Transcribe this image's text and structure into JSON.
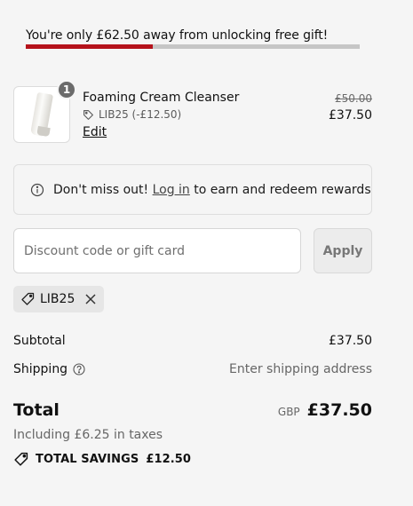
{
  "gift_banner": {
    "message": "You're only £62.50 away from unlocking free gift!",
    "progress_fraction": 0.38,
    "accent_color": "#b5121b"
  },
  "line_item": {
    "quantity": "1",
    "name": "Foaming Cream Cleanser",
    "discount_label": "LIB25 (-£12.50)",
    "edit_label": "Edit",
    "original_price": "£50.00",
    "price": "£37.50",
    "image_icon": "product-tube-image"
  },
  "rewards_notice": {
    "prefix": "Don't miss out!",
    "link_label": "Log in",
    "suffix": "to earn and redeem rewards",
    "icon": "info-icon"
  },
  "discount": {
    "placeholder": "Discount code or gift card",
    "value": "",
    "apply_label": "Apply",
    "applied_code": "LIB25"
  },
  "summary": {
    "subtotal_label": "Subtotal",
    "subtotal_value": "£37.50",
    "shipping_label": "Shipping",
    "shipping_value": "Enter shipping address",
    "total_label": "Total",
    "currency": "GBP",
    "total_value": "£37.50",
    "taxes_note": "Including £6.25 in taxes",
    "savings_label": "TOTAL SAVINGS",
    "savings_value": "£12.50"
  }
}
